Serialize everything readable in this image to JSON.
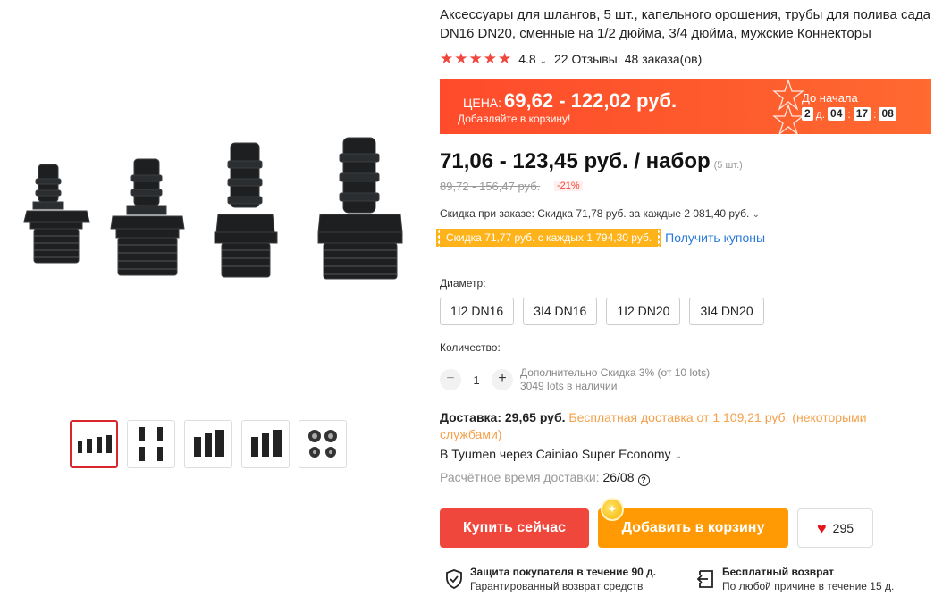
{
  "product": {
    "title": "Аксессуары для шлангов, 5 шт., капельного орошения, трубы для полива сада DN16 DN20, сменные на 1/2 дюйма, 3/4 дюйма, мужские Коннекторы",
    "rating": "4.8",
    "reviews": "22 Отзывы",
    "orders": "48 заказа(ов)"
  },
  "promo": {
    "price_label": "ЦЕНА:",
    "price": "69,62 - 122,02 руб.",
    "sub": "Добавляйте в корзину!",
    "countdown_label": "До начала",
    "days": "2",
    "days_label": "д.",
    "hours": "04",
    "minutes": "17",
    "seconds": "08"
  },
  "price": {
    "main": "71,06 - 123,45 руб. / набор",
    "unit": "(5 шт.)",
    "old": "89,72 - 156,47 руб.",
    "discount": "-21%"
  },
  "discounts": {
    "order_discount": "Скидка при заказе: Скидка 71,78 руб. за каждые 2 081,40 руб.",
    "coupon": "Скидка 71,77 руб. с каждых 1 794,30 руб.",
    "get_coupons": "Получить купоны"
  },
  "diameter": {
    "label": "Диаметр:",
    "options": [
      "1I2 DN16",
      "3I4 DN16",
      "1I2 DN20",
      "3I4 DN20"
    ]
  },
  "quantity": {
    "label": "Количество:",
    "value": "1",
    "minus": "−",
    "plus": "+",
    "extra_discount": "Дополнительно Скидка 3% (от 10 lots)",
    "stock": "3049 lots в наличии"
  },
  "shipping": {
    "label": "Доставка: 29,65 руб.",
    "free": "Бесплатная доставка от 1 109,21 руб. (некоторыми службами)",
    "via": "В Tyumen через Cainiao Super Economy",
    "eta_label": "Расчётное время доставки:",
    "eta_date": "26/08",
    "help": "?"
  },
  "actions": {
    "buy_now": "Купить сейчас",
    "add_to_cart": "Добавить в корзину",
    "wishlist_count": "295"
  },
  "guarantees": [
    {
      "title": "Защита покупателя в течение 90 д.",
      "subtitle": "Гарантированный возврат средств"
    },
    {
      "title": "Бесплатный возврат",
      "subtitle": "По любой причине в течение 15 д."
    }
  ],
  "icons": {
    "star": "star-icon",
    "heart": "heart-icon",
    "shield": "shield-check-icon",
    "return": "return-box-icon",
    "coin": "coin-icon"
  },
  "colors": {
    "accent_red": "#f0473d",
    "cart_orange": "#ff9a05",
    "promo_orange": "#ff4b2b",
    "coupon_yellow": "#ffb31a",
    "link_blue": "#2979d9"
  }
}
